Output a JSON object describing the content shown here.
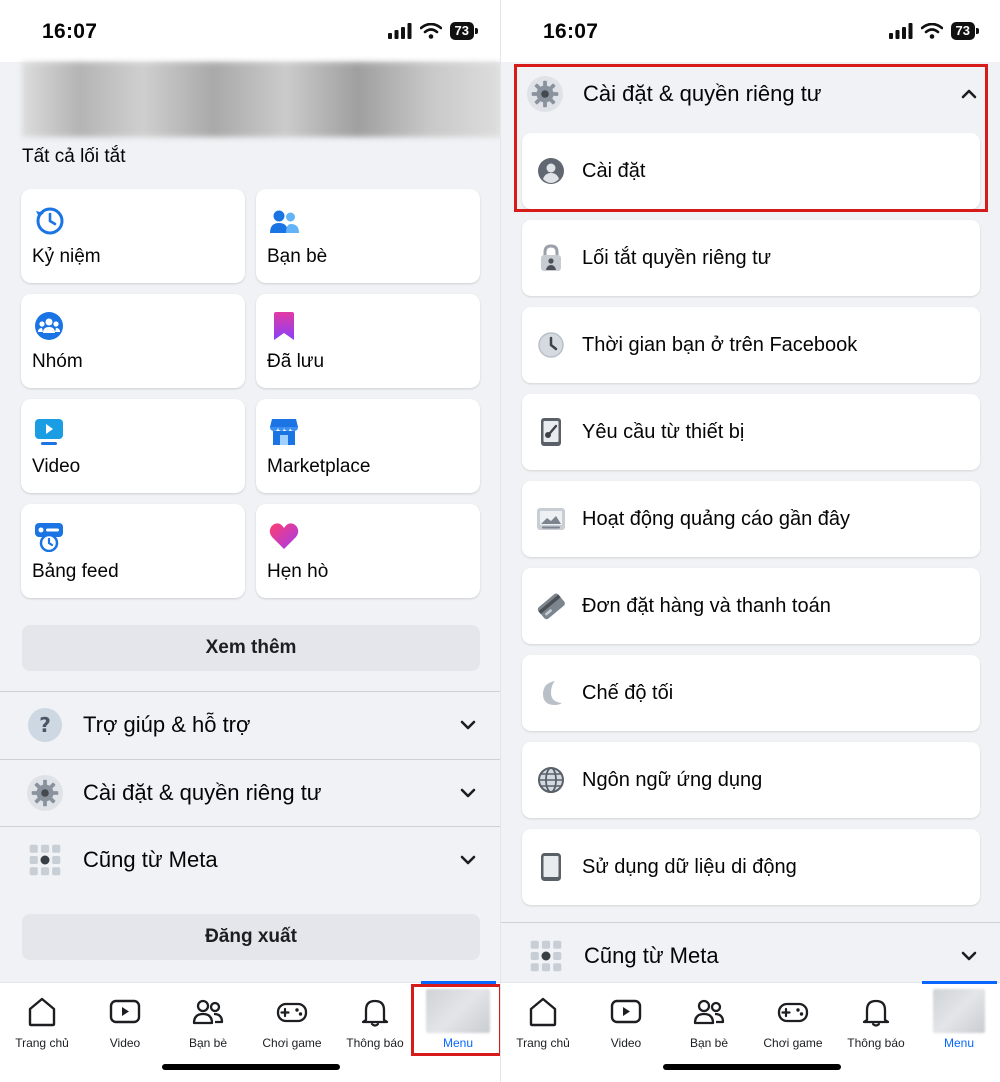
{
  "status": {
    "time": "16:07",
    "battery": "73"
  },
  "left": {
    "shortcuts_title": "Tất cả lối tắt",
    "tiles": [
      {
        "label": "Kỷ niệm",
        "icon": "memories-clock-icon"
      },
      {
        "label": "Bạn bè",
        "icon": "friends-icon"
      },
      {
        "label": "Nhóm",
        "icon": "groups-icon"
      },
      {
        "label": "Đã lưu",
        "icon": "saved-bookmark-icon"
      },
      {
        "label": "Video",
        "icon": "video-icon"
      },
      {
        "label": "Marketplace",
        "icon": "marketplace-store-icon"
      },
      {
        "label": "Bảng feed",
        "icon": "feeds-icon"
      },
      {
        "label": "Hẹn hò",
        "icon": "dating-heart-icon"
      }
    ],
    "see_more": "Xem thêm",
    "sections": [
      {
        "label": "Trợ giúp & hỗ trợ",
        "icon": "help-question-icon"
      },
      {
        "label": "Cài đặt & quyền riêng tư",
        "icon": "gear-icon"
      },
      {
        "label": "Cũng từ Meta",
        "icon": "apps-grid-icon"
      }
    ],
    "logout": "Đăng xuất"
  },
  "right": {
    "header": {
      "label": "Cài đặt & quyền riêng tư",
      "icon": "gear-icon"
    },
    "items": [
      {
        "label": "Cài đặt",
        "icon": "profile-settings-icon"
      },
      {
        "label": "Lối tắt quyền riêng tư",
        "icon": "privacy-lock-icon"
      },
      {
        "label": "Thời gian bạn ở trên Facebook",
        "icon": "clock-icon"
      },
      {
        "label": "Yêu cầu từ thiết bị",
        "icon": "device-key-icon"
      },
      {
        "label": "Hoạt động quảng cáo gần đây",
        "icon": "ad-activity-icon"
      },
      {
        "label": "Đơn đặt hàng và thanh toán",
        "icon": "payment-card-icon"
      },
      {
        "label": "Chế độ tối",
        "icon": "moon-icon"
      },
      {
        "label": "Ngôn ngữ ứng dụng",
        "icon": "globe-icon"
      },
      {
        "label": "Sử dụng dữ liệu di động",
        "icon": "mobile-phone-icon"
      }
    ],
    "meta_section": {
      "label": "Cũng từ Meta",
      "icon": "apps-grid-icon"
    }
  },
  "nav": [
    {
      "label": "Trang chủ",
      "icon": "home-icon"
    },
    {
      "label": "Video",
      "icon": "video-play-icon"
    },
    {
      "label": "Bạn bè",
      "icon": "friends-icon"
    },
    {
      "label": "Chơi game",
      "icon": "gamepad-icon"
    },
    {
      "label": "Thông báo",
      "icon": "bell-icon"
    },
    {
      "label": "Menu",
      "icon": "profile-avatar"
    }
  ],
  "colors": {
    "accent": "#0866ff",
    "highlight_box": "#d71a1a",
    "background": "#f0f2f5"
  }
}
